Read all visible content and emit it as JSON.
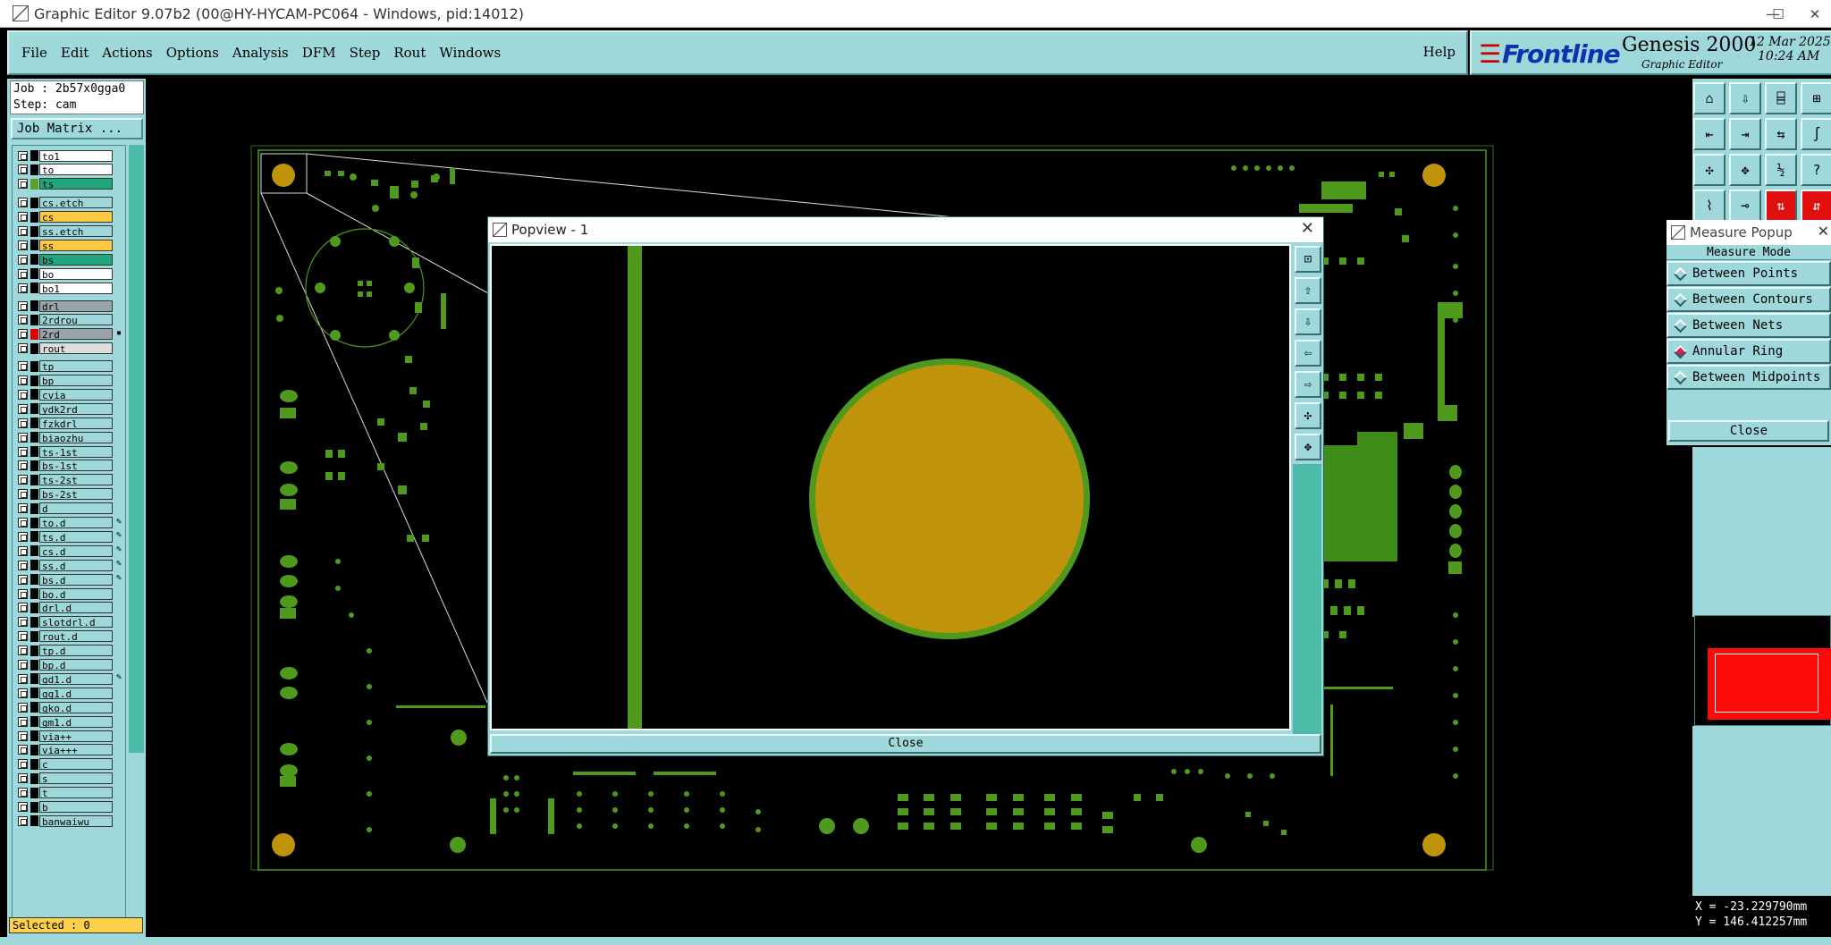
{
  "window": {
    "title": "Graphic Editor 9.07b2 (00@HY-HYCAM-PC064 - Windows, pid:14012)",
    "min": "—",
    "max": "☐",
    "close": "✕"
  },
  "menu": [
    "File",
    "Edit",
    "Actions",
    "Options",
    "Analysis",
    "DFM",
    "Step",
    "Rout",
    "Windows"
  ],
  "help": "Help",
  "brand": {
    "logo": "Frontline",
    "product": "Genesis 2000",
    "subtitle": "Graphic Editor",
    "date": "12 Mar 2025",
    "time": "10:24 AM"
  },
  "job": {
    "job": "Job : 2b57x0gga0",
    "step": "Step: cam"
  },
  "job_matrix": "Job Matrix ...",
  "layers": [
    {
      "name": "to1",
      "color": "#ffffff",
      "swatch": "#000000",
      "mark": ""
    },
    {
      "name": "to",
      "color": "#ffffff",
      "swatch": "#000000",
      "mark": ""
    },
    {
      "name": "ts",
      "color": "#1ea87a",
      "swatch": "#5aa02c",
      "mark": ""
    },
    {
      "name": "cs.etch",
      "color": "#9fd8da",
      "swatch": "#000000",
      "mark": ""
    },
    {
      "name": "cs",
      "color": "#ffc840",
      "swatch": "#000000",
      "mark": ""
    },
    {
      "name": "ss.etch",
      "color": "#9fd8da",
      "swatch": "#000000",
      "mark": ""
    },
    {
      "name": "ss",
      "color": "#ffc840",
      "swatch": "#000000",
      "mark": ""
    },
    {
      "name": "bs",
      "color": "#1ea87a",
      "swatch": "#000000",
      "mark": ""
    },
    {
      "name": "bo",
      "color": "#ffffff",
      "swatch": "#000000",
      "mark": ""
    },
    {
      "name": "bo1",
      "color": "#ffffff",
      "swatch": "#000000",
      "mark": ""
    },
    {
      "name": "drl",
      "color": "#9aa5aa",
      "swatch": "#000000",
      "mark": ""
    },
    {
      "name": "2rdrou",
      "color": "#9fd8da",
      "swatch": "#000000",
      "mark": ""
    },
    {
      "name": "2rd",
      "color": "#9aa5aa",
      "swatch": "#e00000",
      "mark": "▪"
    },
    {
      "name": "rout",
      "color": "#dddddd",
      "swatch": "#000000",
      "mark": ""
    },
    {
      "name": "tp",
      "color": "#9fd8da",
      "swatch": "#000000",
      "mark": ""
    },
    {
      "name": "bp",
      "color": "#9fd8da",
      "swatch": "#000000",
      "mark": ""
    },
    {
      "name": "cvia",
      "color": "#9fd8da",
      "swatch": "#000000",
      "mark": ""
    },
    {
      "name": "ydk2rd",
      "color": "#9fd8da",
      "swatch": "#000000",
      "mark": ""
    },
    {
      "name": "fzkdrl",
      "color": "#9fd8da",
      "swatch": "#000000",
      "mark": ""
    },
    {
      "name": "biaozhu",
      "color": "#9fd8da",
      "swatch": "#000000",
      "mark": ""
    },
    {
      "name": "ts-1st",
      "color": "#9fd8da",
      "swatch": "#000000",
      "mark": ""
    },
    {
      "name": "bs-1st",
      "color": "#9fd8da",
      "swatch": "#000000",
      "mark": ""
    },
    {
      "name": "ts-2st",
      "color": "#9fd8da",
      "swatch": "#000000",
      "mark": ""
    },
    {
      "name": "bs-2st",
      "color": "#9fd8da",
      "swatch": "#000000",
      "mark": ""
    },
    {
      "name": "d",
      "color": "#9fd8da",
      "swatch": "#000000",
      "mark": ""
    },
    {
      "name": "to.d",
      "color": "#9fd8da",
      "swatch": "#000000",
      "mark": "✎"
    },
    {
      "name": "ts.d",
      "color": "#9fd8da",
      "swatch": "#000000",
      "mark": "✎"
    },
    {
      "name": "cs.d",
      "color": "#9fd8da",
      "swatch": "#000000",
      "mark": "✎"
    },
    {
      "name": "ss.d",
      "color": "#9fd8da",
      "swatch": "#000000",
      "mark": "✎"
    },
    {
      "name": "bs.d",
      "color": "#9fd8da",
      "swatch": "#000000",
      "mark": "✎"
    },
    {
      "name": "bo.d",
      "color": "#9fd8da",
      "swatch": "#000000",
      "mark": ""
    },
    {
      "name": "drl.d",
      "color": "#9fd8da",
      "swatch": "#000000",
      "mark": ""
    },
    {
      "name": "slotdrl.d",
      "color": "#9fd8da",
      "swatch": "#000000",
      "mark": ""
    },
    {
      "name": "rout.d",
      "color": "#9fd8da",
      "swatch": "#000000",
      "mark": ""
    },
    {
      "name": "tp.d",
      "color": "#9fd8da",
      "swatch": "#000000",
      "mark": ""
    },
    {
      "name": "bp.d",
      "color": "#9fd8da",
      "swatch": "#000000",
      "mark": ""
    },
    {
      "name": "gd1.d",
      "color": "#9fd8da",
      "swatch": "#000000",
      "mark": "✎"
    },
    {
      "name": "gg1.d",
      "color": "#9fd8da",
      "swatch": "#000000",
      "mark": ""
    },
    {
      "name": "gko.d",
      "color": "#9fd8da",
      "swatch": "#000000",
      "mark": ""
    },
    {
      "name": "gm1.d",
      "color": "#9fd8da",
      "swatch": "#000000",
      "mark": ""
    },
    {
      "name": "via++",
      "color": "#9fd8da",
      "swatch": "#000000",
      "mark": ""
    },
    {
      "name": "via+++",
      "color": "#9fd8da",
      "swatch": "#000000",
      "mark": ""
    },
    {
      "name": "c",
      "color": "#9fd8da",
      "swatch": "#000000",
      "mark": ""
    },
    {
      "name": "s",
      "color": "#9fd8da",
      "swatch": "#000000",
      "mark": ""
    },
    {
      "name": "t",
      "color": "#9fd8da",
      "swatch": "#000000",
      "mark": ""
    },
    {
      "name": "b",
      "color": "#9fd8da",
      "swatch": "#000000",
      "mark": ""
    },
    {
      "name": "banwaiwu",
      "color": "#9fd8da",
      "swatch": "#000000",
      "mark": ""
    }
  ],
  "selected": "Selected : 0",
  "popview": {
    "title": "Popview - 1",
    "close": "Close",
    "x": "✕"
  },
  "measure": {
    "title": "Measure Popup",
    "x": "✕",
    "mode_label": "Measure Mode",
    "options": [
      {
        "label": "Between Points",
        "active": false
      },
      {
        "label": "Between Contours",
        "active": false
      },
      {
        "label": "Between Nets",
        "active": false
      },
      {
        "label": "Annular Ring",
        "active": true
      },
      {
        "label": "Between Midpoints",
        "active": false
      }
    ],
    "close": "Close"
  },
  "coords": {
    "x": "X = -23.229790mm",
    "y": "Y = 146.412257mm"
  },
  "colors": {
    "pcb_green": "#4f9a1c",
    "pad_gold": "#c0940a",
    "panel": "#9fd8da",
    "accent_teal": "#1ea87a"
  }
}
